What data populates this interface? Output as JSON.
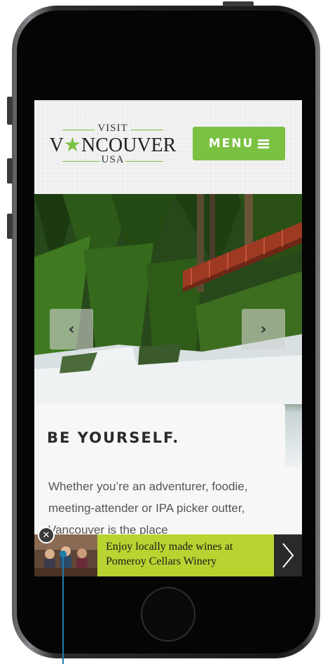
{
  "logo": {
    "visit": "VISIT",
    "main_left": "V",
    "main_right": "NCOUVER",
    "usa": "USA"
  },
  "header": {
    "menu_label": "MENU"
  },
  "hero": {
    "prev_glyph": "‹",
    "next_glyph": "›",
    "caption_title": "BE YOURSELF."
  },
  "content": {
    "body_text": "Whether you’re an adventurer, foodie, meeting-attender or IPA picker outter, Vancouver is the place"
  },
  "ad": {
    "text": "Enjoy locally made wines at Pomeroy Cellars Winery",
    "close_glyph": "✕"
  },
  "colors": {
    "brand_green": "#7ac142",
    "ad_green": "#b8d431",
    "pointer_blue": "#1f7fa8"
  }
}
